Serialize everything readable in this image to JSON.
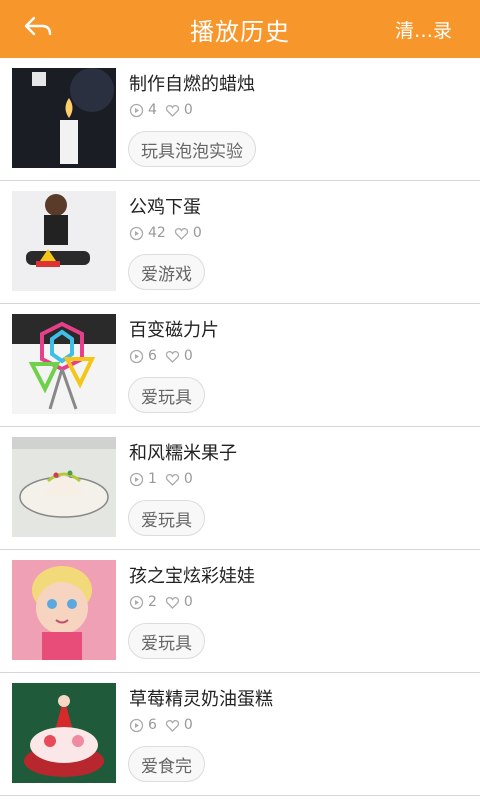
{
  "header": {
    "title": "播放历史",
    "clear_label": "清…录",
    "background": "#f7962b"
  },
  "items": [
    {
      "title": "制作自燃的蜡烛",
      "views": "4",
      "likes": "0",
      "tag": "玩具泡泡实验"
    },
    {
      "title": "公鸡下蛋",
      "views": "42",
      "likes": "0",
      "tag": "爱游戏"
    },
    {
      "title": "百变磁力片",
      "views": "6",
      "likes": "0",
      "tag": "爱玩具"
    },
    {
      "title": "和风糯米果子",
      "views": "1",
      "likes": "0",
      "tag": "爱玩具"
    },
    {
      "title": "孩之宝炫彩娃娃",
      "views": "2",
      "likes": "0",
      "tag": "爱玩具"
    },
    {
      "title": "草莓精灵奶油蛋糕",
      "views": "6",
      "likes": "0",
      "tag": "爱食完"
    }
  ]
}
